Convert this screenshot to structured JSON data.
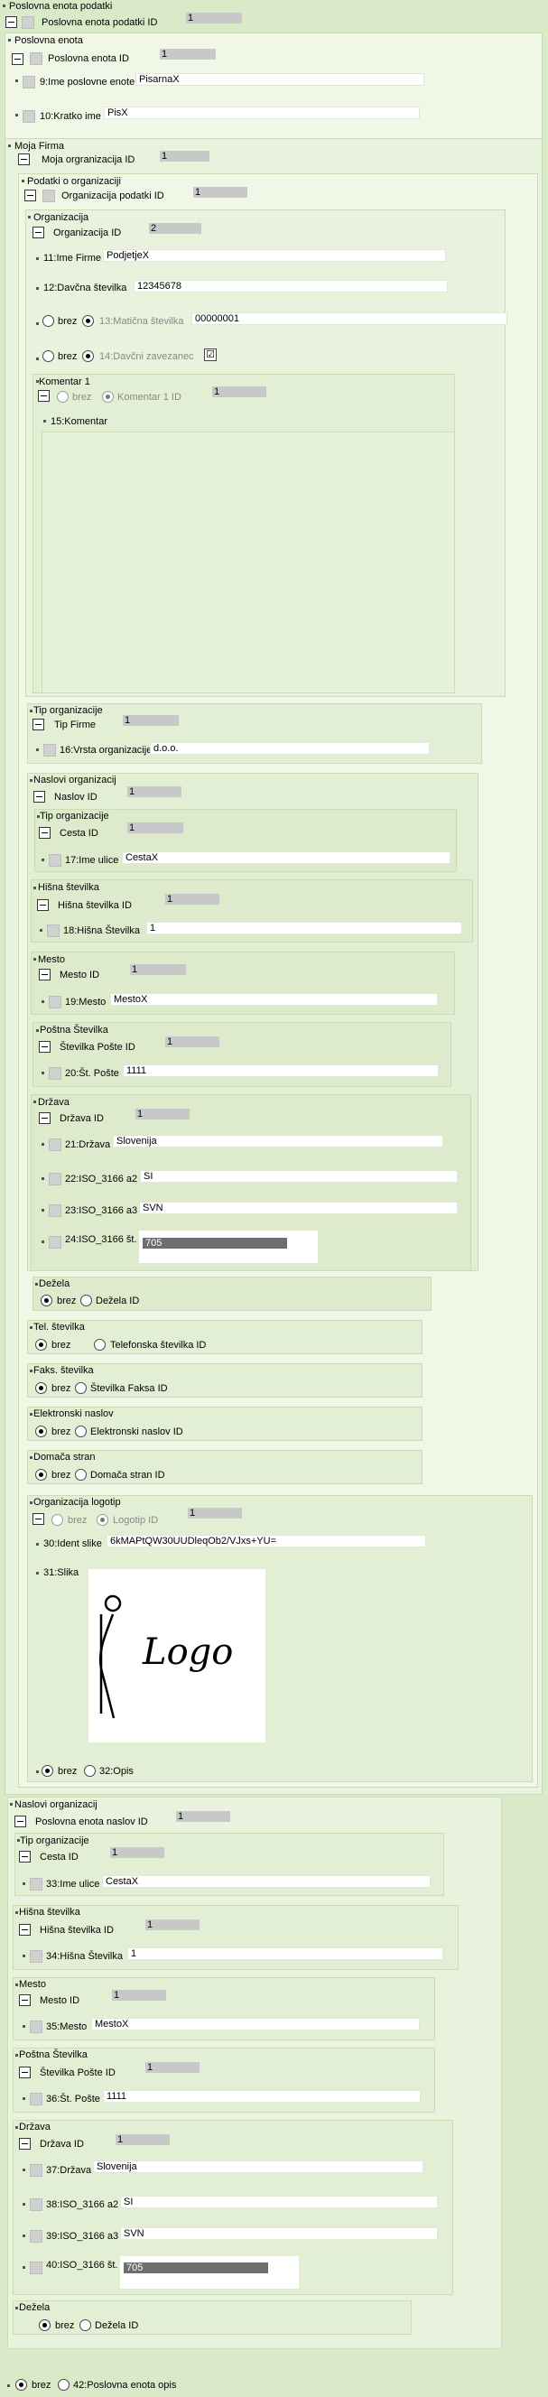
{
  "root": {
    "title": "Poslovna enota podatki",
    "id_label": "Poslovna enota podatki ID",
    "id_value": "1"
  },
  "pe": {
    "group": "Poslovna enota",
    "id_label": "Poslovna enota ID",
    "id_value": "1",
    "ime_label": "9:Ime poslovne enote",
    "ime_value": "PisarnaX",
    "kratko_label": "10:Kratko ime",
    "kratko_value": "PisX"
  },
  "mf": {
    "group": "Moja Firma",
    "id_label": "Moja orgranizacija ID",
    "id_value": "1"
  },
  "po": {
    "group": "Podatki o organizaciji",
    "id_label": "Organizacija podatki ID",
    "id_value": "1"
  },
  "org": {
    "group": "Organizacija",
    "id_label": "Organizacija ID",
    "id_value": "2",
    "ime_label": "11:Ime Firme",
    "ime_value": "PodjetjeX",
    "davcna_label": "12:Davčna številka",
    "davcna_value": "12345678",
    "brez": "brez",
    "maticna_label": "13:Matična številka",
    "maticna_value": "00000001",
    "zavezanec_label": "14:Davčni zavezanec",
    "zavezanec_check": "☑"
  },
  "komentar": {
    "group": "Komentar 1",
    "brez": "brez",
    "id_label": "Komentar 1 ID",
    "id_value": "1",
    "label": "15:Komentar"
  },
  "tip": {
    "group": "Tip organizacije",
    "id_label": "Tip Firme",
    "id_value": "1",
    "vrsta_label": "16:Vrsta organizacije",
    "vrsta_value": "d.o.o."
  },
  "naslovi": {
    "group": "Naslovi organizacij",
    "id_label": "Naslov ID",
    "id_value": "1",
    "tip_group": "Tip organizacije",
    "cesta_label": "Cesta ID",
    "cesta_value": "1",
    "ulica_label": "17:Ime ulice",
    "ulica_value": "CestaX",
    "hs_group": "Hišna številka",
    "hs_label": "Hišna številka ID",
    "hs_value": "1",
    "hs_f_label": "18:Hišna Številka",
    "hs_f_value": "1",
    "mesto_group": "Mesto",
    "mesto_label": "Mesto ID",
    "mesto_value": "1",
    "mesto_f_label": "19:Mesto",
    "mesto_f_value": "MestoX",
    "posta_group": "Poštna Številka",
    "posta_label": "Številka Pošte ID",
    "posta_value": "1",
    "posta_f_label": "20:Št. Pošte",
    "posta_f_value": "1111",
    "drzava_group": "Država",
    "drzava_label": "Država ID",
    "drzava_value": "1",
    "d21_label": "21:Država",
    "d21_value": "Slovenija",
    "d22_label": "22:ISO_3166 a2",
    "d22_value": "SI",
    "d23_label": "23:ISO_3166 a3",
    "d23_value": "SVN",
    "d24_label": "24:ISO_3166 št.",
    "d24_value": "705",
    "dezela_group": "Dežela",
    "brez": "brez",
    "dezela_label": "Dežela ID"
  },
  "tel": {
    "group": "Tel. številka",
    "brez": "brez",
    "label": "Telefonska številka ID"
  },
  "faks": {
    "group": "Faks. številka",
    "brez": "brez",
    "label": "Številka Faksa ID"
  },
  "email": {
    "group": "Elektronski naslov",
    "brez": "brez",
    "label": "Elektronski naslov ID"
  },
  "web": {
    "group": "Domača stran",
    "brez": "brez",
    "label": "Domača stran ID"
  },
  "logo": {
    "group": "Organizacija logotip",
    "brez": "brez",
    "id_label": "Logotip ID",
    "id_value": "1",
    "ident_label": "30:Ident slike",
    "ident_value": "6kMAPtQW30UUDleqOb2/VJxs+YU=",
    "slika_label": "31:Slika",
    "logo_text": "Logo"
  },
  "opis": {
    "brez": "brez",
    "label": "32:Opis"
  },
  "pen": {
    "group": "Naslovi organizacij",
    "id_label": "Poslovna enota naslov ID",
    "id_value": "1",
    "tip_group": "Tip organizacije",
    "cesta_label": "Cesta ID",
    "cesta_value": "1",
    "ulica_label": "33:Ime ulice",
    "ulica_value": "CestaX",
    "hs_group": "Hišna številka",
    "hs_label": "Hišna številka ID",
    "hs_value": "1",
    "hs_f_label": "34:Hišna Številka",
    "hs_f_value": "1",
    "mesto_group": "Mesto",
    "mesto_label": "Mesto ID",
    "mesto_value": "1",
    "mesto_f_label": "35:Mesto",
    "mesto_f_value": "MestoX",
    "posta_group": "Poštna Številka",
    "posta_label": "Številka Pošte ID",
    "posta_value": "1",
    "posta_f_label": "36:Št. Pošte",
    "posta_f_value": "1111",
    "drzava_group": "Država",
    "drzava_label": "Država ID",
    "drzava_value": "1",
    "d37_label": "37:Država",
    "d37_value": "Slovenija",
    "d38_label": "38:ISO_3166 a2",
    "d38_value": "SI",
    "d39_label": "39:ISO_3166 a3",
    "d39_value": "SVN",
    "d40_label": "40:ISO_3166 št.",
    "d40_value": "705",
    "dezela_group": "Dežela",
    "brez": "brez",
    "dezela_label": "Dežela ID"
  },
  "final": {
    "brez": "brez",
    "label": "42:Poslovna enota opis"
  }
}
